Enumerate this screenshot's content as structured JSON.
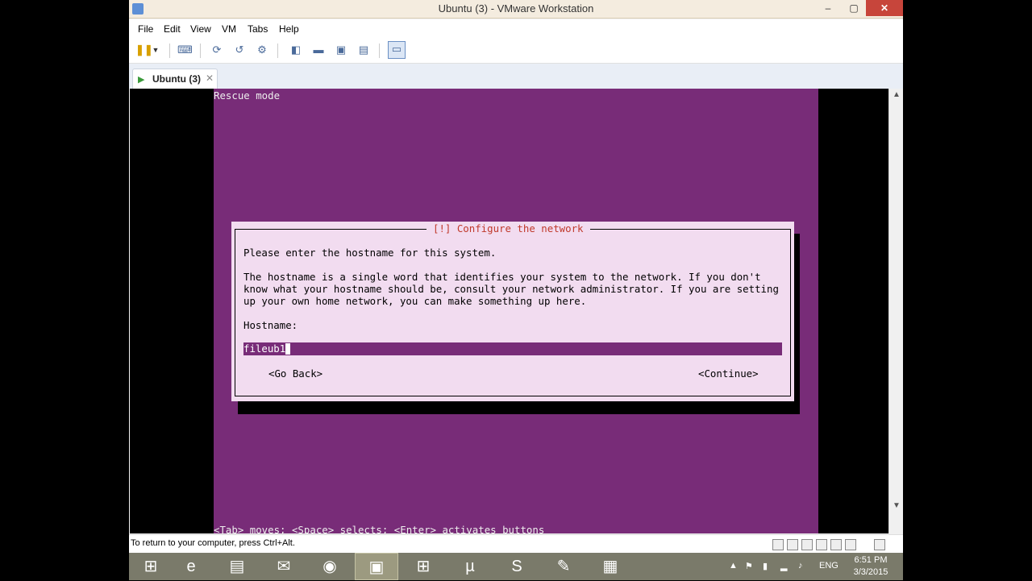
{
  "window": {
    "title": "Ubuntu (3) - VMware Workstation",
    "controls": {
      "minimize": "–",
      "maximize": "▢",
      "close": "✕"
    }
  },
  "menu": [
    "File",
    "Edit",
    "View",
    "VM",
    "Tabs",
    "Help"
  ],
  "toolbar_icons": [
    "pause-icon",
    "dropdown-arrow-icon",
    "send-ctrl-alt-del-icon",
    "snapshot-take-icon",
    "snapshot-revert-icon",
    "snapshot-manager-icon",
    "fullscreen-icon",
    "unity-icon",
    "console-view-icon",
    "library-icon",
    "thumbnail-icon"
  ],
  "tab": {
    "label": "Ubuntu (3)",
    "close": "✕"
  },
  "installer": {
    "mode_label": "Rescue mode",
    "dialog_title": "[!] Configure the network",
    "prompt": "Please enter the hostname for this system.",
    "explanation": [
      "The hostname is a single word that identifies your system to the network. If you don't",
      "know what your hostname should be, consult your network administrator. If you are setting",
      "up your own home network, you can make something up here."
    ],
    "hostname_label": "Hostname:",
    "hostname_value": "fileub1",
    "go_back": "<Go Back>",
    "continue": "<Continue>",
    "help_line": "<Tab> moves; <Space> selects; <Enter> activates buttons"
  },
  "status": {
    "message": "To return to your computer, press Ctrl+Alt."
  },
  "taskbar": {
    "apps": [
      "start-icon",
      "internet-explorer-icon",
      "file-explorer-icon",
      "thunderbird-icon",
      "firefox-icon",
      "vmware-icon",
      "store-icon",
      "utorrent-icon",
      "skype-icon",
      "notepad-icon",
      "media-icon"
    ],
    "language": "ENG",
    "time": "6:51 PM",
    "date": "3/3/2015"
  }
}
